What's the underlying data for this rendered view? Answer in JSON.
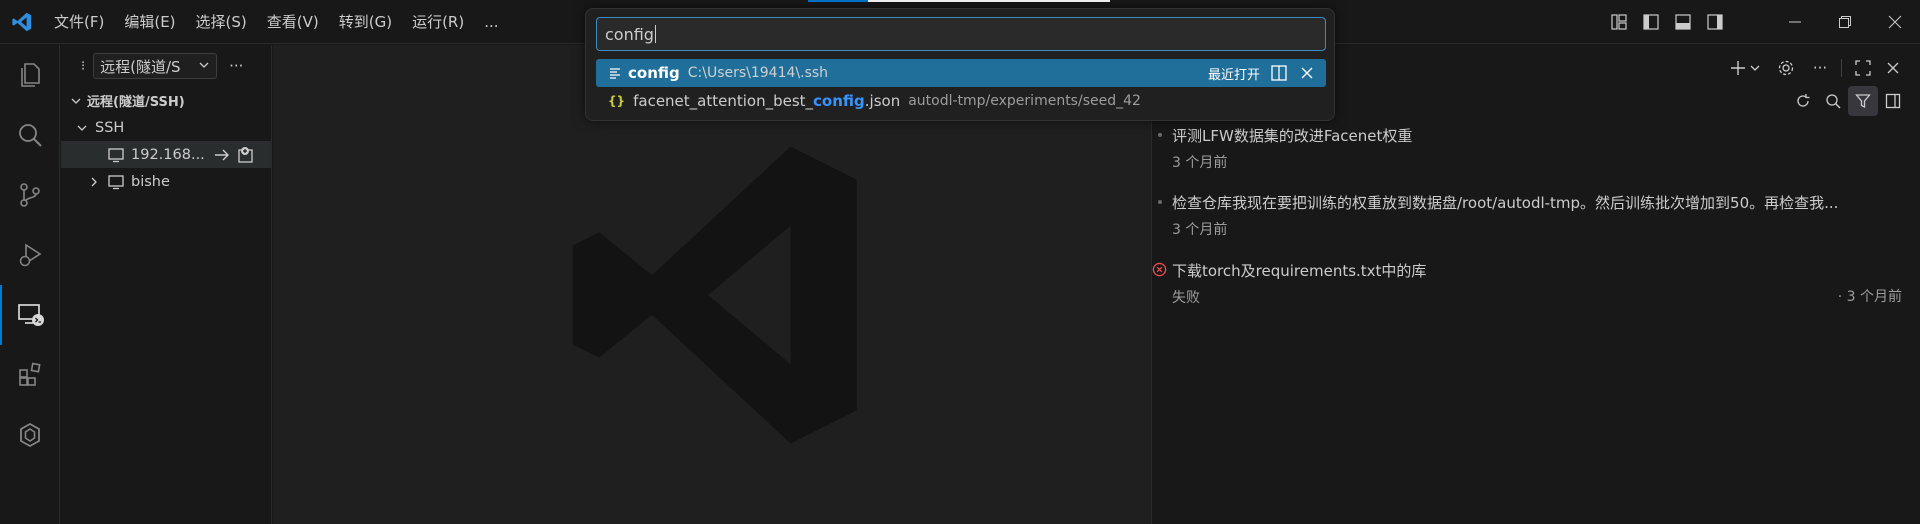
{
  "menu": [
    "文件(F)",
    "编辑(E)",
    "选择(S)",
    "查看(V)",
    "转到(G)",
    "运行(R)",
    "..."
  ],
  "sidebar": {
    "view_select": "远程(隧道/S",
    "section_title": "远程(隧道/SSH)",
    "group": "SSH",
    "hosts": [
      {
        "label": "192.168..."
      },
      {
        "label": "bishe"
      }
    ]
  },
  "quick_pick": {
    "input_value": "config",
    "results": [
      {
        "name": "config",
        "description": "C:\\Users\\19414\\.ssh",
        "badge": "最近打开"
      },
      {
        "name_prefix": "facenet_attention_best_",
        "name_match": "config",
        "name_suffix": ".json",
        "description": "autodl-tmp/experiments/seed_42"
      }
    ]
  },
  "tasks": [
    {
      "title": "评测LFW数据集的改进Facenet权重",
      "subtitle": "3 个月前"
    },
    {
      "title": "检查仓库我现在要把训练的权重放到数据盘/root/autodl-tmp。然后训练批次增加到50。再检查我...",
      "subtitle": "3 个月前"
    },
    {
      "title": "下载torch及requirements.txt中的库",
      "subtitle": "失败",
      "time": "· 3 个月前",
      "status": "error"
    }
  ],
  "colors": {
    "accent": "#0078d4",
    "selection": "#1f6f9a",
    "match": "#3794ff",
    "error": "#f14c4c"
  }
}
